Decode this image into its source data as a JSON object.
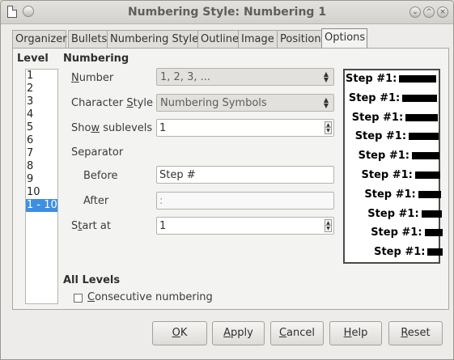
{
  "window": {
    "title": "Numbering Style: Numbering 1"
  },
  "tabs": [
    "Organizer",
    "Bullets",
    "Numbering Style",
    "Outline",
    "Image",
    "Position",
    "Options"
  ],
  "level": {
    "heading": "Level",
    "items": [
      "1",
      "2",
      "3",
      "4",
      "5",
      "6",
      "7",
      "8",
      "9",
      "10",
      "1 - 10"
    ],
    "selected": "1 - 10"
  },
  "numbering": {
    "heading": "Numbering",
    "number_label_u": "N",
    "number_label_rest": "umber",
    "number_value": "1, 2, 3, ...",
    "char_style_label_pre": "Character ",
    "char_style_label_u": "S",
    "char_style_label_post": "tyle",
    "char_style_value": "Numbering Symbols",
    "sublevels_label_pre": "Sho",
    "sublevels_label_u": "w",
    "sublevels_label_post": " sublevels",
    "sublevels_value": "1",
    "separator_label": "Separator",
    "before_label": "Before",
    "before_value": "Step #",
    "after_label": "After",
    "after_value": ":",
    "start_label_pre": "S",
    "start_label_u": "t",
    "start_label_post": "art at",
    "start_value": "1"
  },
  "preview": {
    "text": "Step #1:",
    "levels": 10
  },
  "all_levels": {
    "heading": "All Levels",
    "consecutive_u": "C",
    "consecutive_rest": "onsecutive numbering",
    "checked": false
  },
  "buttons": {
    "ok_u": "O",
    "ok_rest": "K",
    "apply_u": "A",
    "apply_rest": "pply",
    "cancel_u": "C",
    "cancel_rest": "ancel",
    "help_u": "H",
    "help_rest": "elp",
    "reset_u": "R",
    "reset_rest": "eset"
  }
}
